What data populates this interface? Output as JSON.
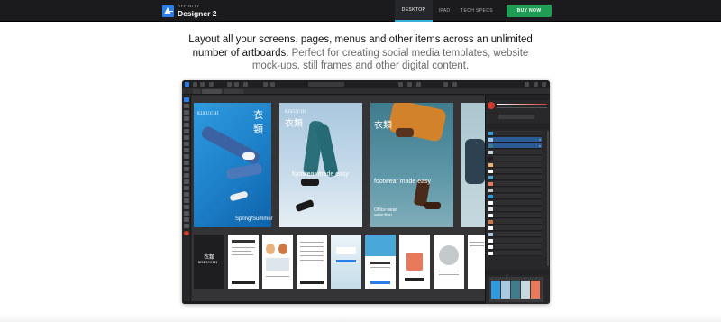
{
  "nav": {
    "brand": "AFFINITY",
    "product": "Designer 2",
    "tabs": [
      {
        "label": "DESKTOP",
        "active": true
      },
      {
        "label": "IPAD",
        "active": false
      },
      {
        "label": "TECH SPECS",
        "active": false
      }
    ],
    "buy_label": "BUY NOW",
    "accent": "#2b7de9",
    "buy_color": "#1f9d55"
  },
  "headline": {
    "main": "Layout all your screens, pages, menus and other items across an unlimited number of artboards.",
    "muted": " Perfect for creating social media templates, website mock-ups, still frames and other digital content."
  },
  "screenshot": {
    "artboards": [
      {
        "logo": "KIKUCHI",
        "kanji": "衣類",
        "tagline": "",
        "caption": "Spring/Summer"
      },
      {
        "logo": "KIKUCHI",
        "kanji": "衣類",
        "tagline": "footwear made easy",
        "caption": ""
      },
      {
        "logo": "",
        "kanji": "衣類",
        "tagline": "footwear made easy",
        "caption": "Office wear selection"
      },
      {
        "logo": "",
        "kanji": "",
        "tagline": "",
        "caption": ""
      }
    ],
    "mini_logo": "KIKUCHI",
    "mini_kanji": "衣類"
  }
}
